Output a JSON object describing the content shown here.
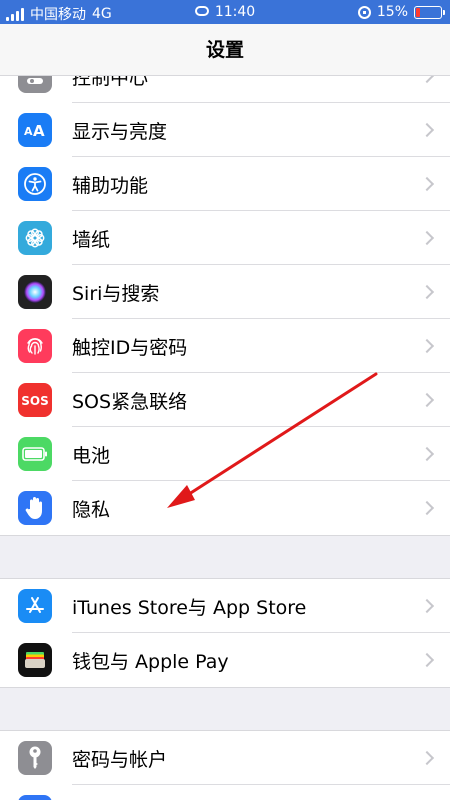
{
  "status": {
    "carrier": "中国移动",
    "network": "4G",
    "time": "11:40",
    "battery": "15%"
  },
  "nav": {
    "title": "设置"
  },
  "groups": [
    {
      "items": [
        {
          "label": "控制中心",
          "icon": "control-center-icon",
          "color": "#8e8e93"
        },
        {
          "label": "显示与亮度",
          "icon": "display-icon",
          "color": "#1a7cf5"
        },
        {
          "label": "辅助功能",
          "icon": "accessibility-icon",
          "color": "#1a7cf5"
        },
        {
          "label": "墙纸",
          "icon": "wallpaper-icon",
          "color": "#34aadc"
        },
        {
          "label": "Siri与搜索",
          "icon": "siri-icon",
          "color": "#222"
        },
        {
          "label": "触控ID与密码",
          "icon": "fingerprint-icon",
          "color": "#ff3b5c"
        },
        {
          "label": "SOS紧急联络",
          "icon": "sos-icon",
          "color": "#f0312e"
        },
        {
          "label": "电池",
          "icon": "battery-icon",
          "color": "#4cd964"
        },
        {
          "label": "隐私",
          "icon": "hand-icon",
          "color": "#2f75f5"
        }
      ]
    },
    {
      "items": [
        {
          "label": "iTunes Store与 App Store",
          "icon": "app-store-icon",
          "color": "#1a8cf5"
        },
        {
          "label": "钱包与 Apple Pay",
          "icon": "wallet-icon",
          "color": "#111"
        }
      ]
    },
    {
      "items": [
        {
          "label": "密码与帐户",
          "icon": "key-icon",
          "color": "#8e8e93"
        }
      ]
    }
  ],
  "colors": {
    "statusbar": "#3a73d8",
    "arrow": "#e0191a"
  }
}
